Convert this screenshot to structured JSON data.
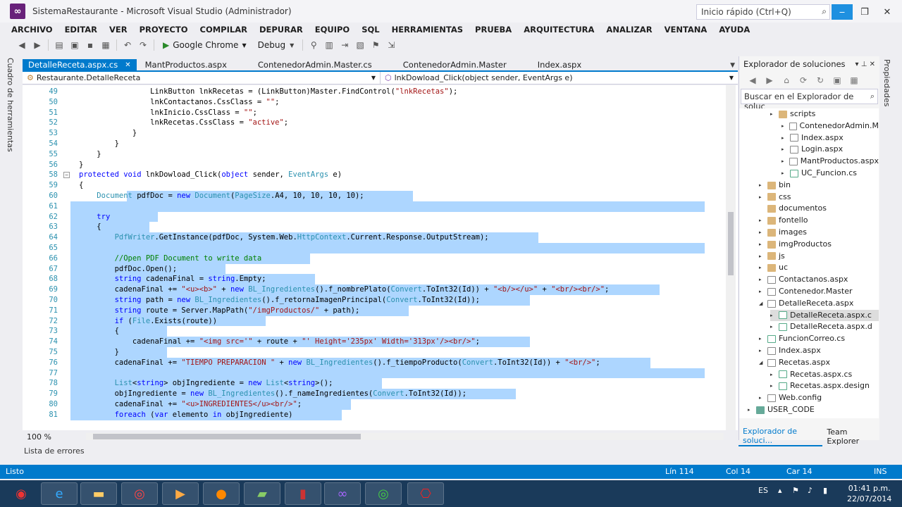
{
  "window": {
    "title": "SistemaRestaurante - Microsoft Visual Studio (Administrador)",
    "quick_launch_placeholder": "Inicio rápido (Ctrl+Q)"
  },
  "menu": [
    "ARCHIVO",
    "EDITAR",
    "VER",
    "PROYECTO",
    "COMPILAR",
    "DEPURAR",
    "EQUIPO",
    "SQL",
    "HERRAMIENTAS",
    "PRUEBA",
    "ARQUITECTURA",
    "ANALIZAR",
    "VENTANA",
    "AYUDA"
  ],
  "toolbar": {
    "browser": "Google Chrome",
    "configuration": "Debug"
  },
  "side_panels": {
    "left": "Cuadro de herramientas",
    "right": "Propiedades"
  },
  "tabs": [
    {
      "label": "DetalleReceta.aspx.cs",
      "active": true
    },
    {
      "label": "MantProductos.aspx",
      "active": false
    },
    {
      "label": "ContenedorAdmin.Master.cs",
      "active": false
    },
    {
      "label": "ContenedorAdmin.Master",
      "active": false
    },
    {
      "label": "Index.aspx",
      "active": false
    }
  ],
  "navbar": {
    "class_scope": "Restaurante.DetalleReceta",
    "member": "lnkDowload_Click(object sender, EventArgs e)"
  },
  "code_lines": [
    {
      "n": "49",
      "t": "                LinkButton lnkRecetas = (LinkButton)Master.FindControl(\"lnkRecetas\");"
    },
    {
      "n": "50",
      "t": "                lnkContactanos.CssClass = \"\";"
    },
    {
      "n": "51",
      "t": "                lnkInicio.CssClass = \"\";"
    },
    {
      "n": "52",
      "t": "                lnkRecetas.CssClass = \"active\";"
    },
    {
      "n": "53",
      "t": "            }"
    },
    {
      "n": "54",
      "t": "        }"
    },
    {
      "n": "55",
      "t": "    }"
    },
    {
      "n": "56",
      "t": "}"
    },
    {
      "n": "58",
      "t": "protected void lnkDowload_Click(object sender, EventArgs e)"
    },
    {
      "n": "59",
      "t": "{"
    },
    {
      "n": "60",
      "t": "    Document pdfDoc = new Document(PageSize.A4, 10, 10, 10, 10);"
    },
    {
      "n": "61",
      "t": ""
    },
    {
      "n": "62",
      "t": "    try"
    },
    {
      "n": "63",
      "t": "    {"
    },
    {
      "n": "64",
      "t": "        PdfWriter.GetInstance(pdfDoc, System.Web.HttpContext.Current.Response.OutputStream);"
    },
    {
      "n": "65",
      "t": ""
    },
    {
      "n": "66",
      "t": "        //Open PDF Document to write data"
    },
    {
      "n": "67",
      "t": "        pdfDoc.Open();"
    },
    {
      "n": "68",
      "t": "        string cadenaFinal = string.Empty;"
    },
    {
      "n": "69",
      "t": "        cadenaFinal += \"<u><b>\" + new BL_Ingredientes().f_nombrePlato(Convert.ToInt32(Id)) + \"<b/></u>\" + \"<br/><br/>\";"
    },
    {
      "n": "70",
      "t": "        string path = new BL_Ingredientes().f_retornaImagenPrincipal(Convert.ToInt32(Id));"
    },
    {
      "n": "71",
      "t": "        string route = Server.MapPath(\"/imgProductos/\" + path);"
    },
    {
      "n": "72",
      "t": "        if (File.Exists(route))"
    },
    {
      "n": "73",
      "t": "        {"
    },
    {
      "n": "74",
      "t": "            cadenaFinal += \"<img src='\" + route + \"' Height='235px' Width='313px'/><br/>\";"
    },
    {
      "n": "75",
      "t": "        }"
    },
    {
      "n": "76",
      "t": "        cadenaFinal += \"TIEMPO PREPARACION \" + new BL_Ingredientes().f_tiempoProducto(Convert.ToInt32(Id)) + \"<br/>\";"
    },
    {
      "n": "77",
      "t": ""
    },
    {
      "n": "78",
      "t": "        List<string> objIngrediente = new List<string>();"
    },
    {
      "n": "79",
      "t": "        objIngrediente = new BL_Ingredientes().f_nameIngredientes(Convert.ToInt32(Id));"
    },
    {
      "n": "80",
      "t": "        cadenaFinal += \"<u>INGREDIENTES</u><br/>\";"
    },
    {
      "n": "81",
      "t": "        foreach (var elemento in objIngrediente)"
    }
  ],
  "zoom": "100 %",
  "error_list": "Lista de errores",
  "solution_explorer": {
    "title": "Explorador de soluciones",
    "search_placeholder": "Buscar en el Explorador de soluc",
    "items": [
      {
        "label": "scripts",
        "icon": "folder"
      },
      {
        "label": "ContenedorAdmin.M",
        "icon": "file"
      },
      {
        "label": "Index.aspx",
        "icon": "file"
      },
      {
        "label": "Login.aspx",
        "icon": "file"
      },
      {
        "label": "MantProductos.aspx",
        "icon": "file"
      },
      {
        "label": "UC_Funcion.cs",
        "icon": "cs"
      },
      {
        "label": "bin",
        "icon": "folder"
      },
      {
        "label": "css",
        "icon": "folder"
      },
      {
        "label": "documentos",
        "icon": "folder"
      },
      {
        "label": "fontello",
        "icon": "folder"
      },
      {
        "label": "images",
        "icon": "folder"
      },
      {
        "label": "imgProductos",
        "icon": "folder"
      },
      {
        "label": "js",
        "icon": "folder"
      },
      {
        "label": "uc",
        "icon": "folder"
      },
      {
        "label": "Contactanos.aspx",
        "icon": "file"
      },
      {
        "label": "Contenedor.Master",
        "icon": "file"
      },
      {
        "label": "DetalleReceta.aspx",
        "icon": "file"
      },
      {
        "label": "DetalleReceta.aspx.c",
        "icon": "cs"
      },
      {
        "label": "DetalleReceta.aspx.d",
        "icon": "cs"
      },
      {
        "label": "FuncionCorreo.cs",
        "icon": "cs"
      },
      {
        "label": "Index.aspx",
        "icon": "file"
      },
      {
        "label": "Recetas.aspx",
        "icon": "file"
      },
      {
        "label": "Recetas.aspx.cs",
        "icon": "cs"
      },
      {
        "label": "Recetas.aspx.design",
        "icon": "cs"
      },
      {
        "label": "Web.config",
        "icon": "file"
      },
      {
        "label": "USER_CODE",
        "icon": "proj"
      }
    ],
    "bottom_tabs": [
      "Explorador de soluci...",
      "Team Explorer"
    ]
  },
  "status": {
    "state": "Listo",
    "line": "Lín 114",
    "col": "Col 14",
    "car": "Car 14",
    "mode": "INS"
  },
  "taskbar": {
    "language": "ES",
    "time": "01:41 p.m.",
    "date": "22/07/2014"
  }
}
